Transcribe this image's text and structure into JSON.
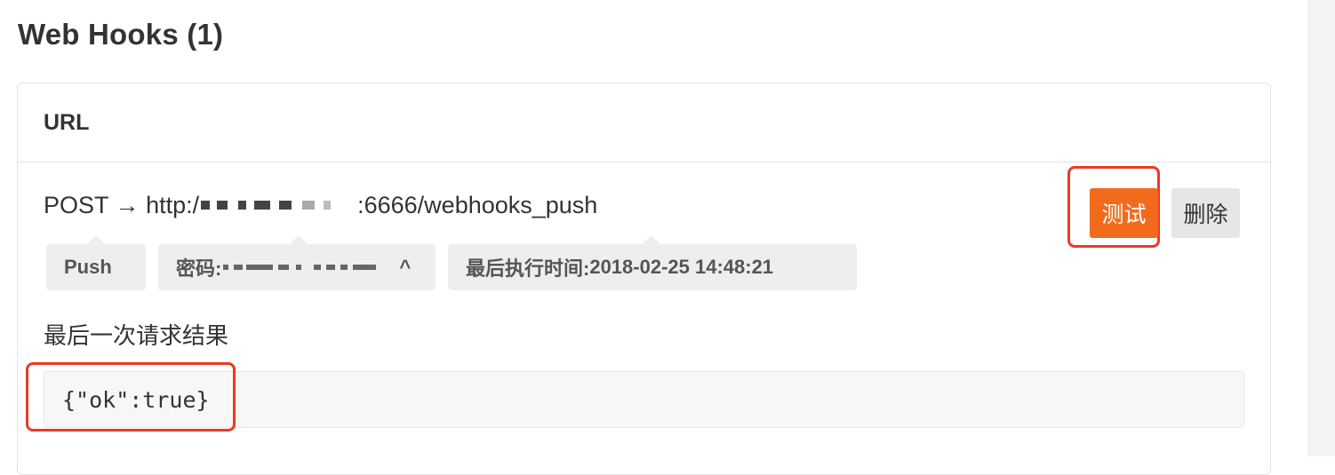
{
  "page": {
    "title": "Web Hooks (1)"
  },
  "card": {
    "header": "URL"
  },
  "hook": {
    "method": "POST",
    "arrow": "→",
    "url_prefix": "http:/",
    "url_suffix": ":6666/webhooks_push"
  },
  "tags": {
    "push": "Push",
    "secret_label": "密码: ",
    "secret_tail": "^",
    "last_run_label": "最后执行时间: ",
    "last_run_value": "2018-02-25 14:48:21"
  },
  "buttons": {
    "test": "测试",
    "delete": "删除"
  },
  "result": {
    "label": "最后一次请求结果",
    "body": "{\"ok\":true}"
  },
  "colors": {
    "accent": "#f26b1d",
    "highlight": "#ea3a24",
    "tag_bg": "#eeeeee"
  }
}
